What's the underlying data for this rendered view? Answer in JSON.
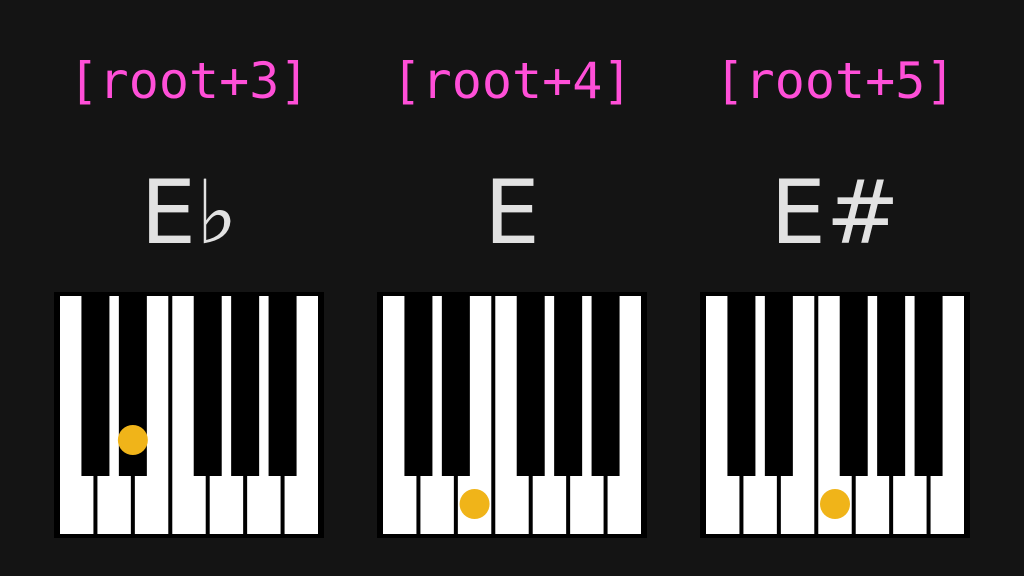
{
  "colors": {
    "background": "#141414",
    "interval_label": "#ff4fd8",
    "note_name": "#e2e2e2",
    "white_key": "#ffffff",
    "black_key": "#000000",
    "marker": "#f0b419"
  },
  "panels": [
    {
      "interval": "[root+3]",
      "note": "E♭",
      "marked_key": {
        "kind": "black",
        "index": 1
      }
    },
    {
      "interval": "[root+4]",
      "note": "E",
      "marked_key": {
        "kind": "white",
        "index": 2
      }
    },
    {
      "interval": "[root+5]",
      "note": "E#",
      "marked_key": {
        "kind": "white",
        "index": 3
      }
    }
  ]
}
